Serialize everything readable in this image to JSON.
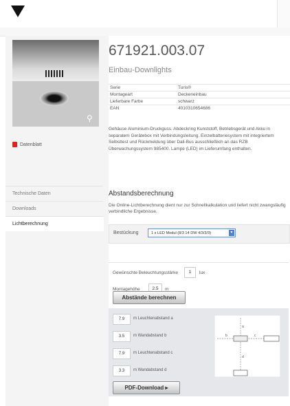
{
  "header": {
    "menu_arrow_icon": "caret-down-icon"
  },
  "product": {
    "title": "671921.003.07",
    "subtitle": "Einbau-Downlights",
    "specs": [
      {
        "key": "Serie",
        "value": "Turis®"
      },
      {
        "key": "Montageart",
        "value": "Deckeneinbau"
      },
      {
        "key": "Lieferbare Farbe",
        "value": "schwarz"
      },
      {
        "key": "EAN",
        "value": "4010310654686"
      }
    ],
    "description": "Gehäuse Aluminium-Druckguss. Abdeckring Kunststoff, Betriebsgerät und Akku in separatem Gerätebox mit Verbindungsleitung. Einzelbatteriesystem mit integriertem Selbsttest und Rückmeldung über Dali-Bus ausschließlich an das RZB Überwachungssystem 985400. Lampe (LED) im Lieferumfang enthalten.",
    "datasheet_label": "Datenblatt"
  },
  "side_nav": {
    "items": [
      {
        "label": "Technische Daten",
        "active": false
      },
      {
        "label": "Downloads",
        "active": false
      },
      {
        "label": "Lichtberechnung",
        "active": true
      }
    ]
  },
  "calculation": {
    "section_title": "Abstandsberechnung",
    "section_desc": "Die Online-Lichtberechnung dient nur zur Schnellkalkulation und liefert nicht zwangsläufig verbindliche Ergebnisse.",
    "bestueckung_label": "Bestückung",
    "bestueckung_value": "1 x LED Modul (8/3 14 DW 4/3/3/3)",
    "illuminance_label": "Gewünschte Beleuchtungsstärke",
    "illuminance_value": "1",
    "illuminance_unit": "lux",
    "height_label": "Montagehöhe",
    "height_value": "2.5",
    "height_unit": "m",
    "calc_button": "Abstände berechnen"
  },
  "results": {
    "rows": [
      {
        "value": "7.9",
        "label": "m Leuchtenabstand a"
      },
      {
        "value": "3.5",
        "label": "m Wandabstand b"
      },
      {
        "value": "7.9",
        "label": "m Leuchtenabstand c"
      },
      {
        "value": "3.3",
        "label": "m Wandabstand d"
      }
    ],
    "pdf_button": "PDF-Download ▸",
    "diagram_labels": [
      "a",
      "b",
      "c",
      "d"
    ]
  }
}
